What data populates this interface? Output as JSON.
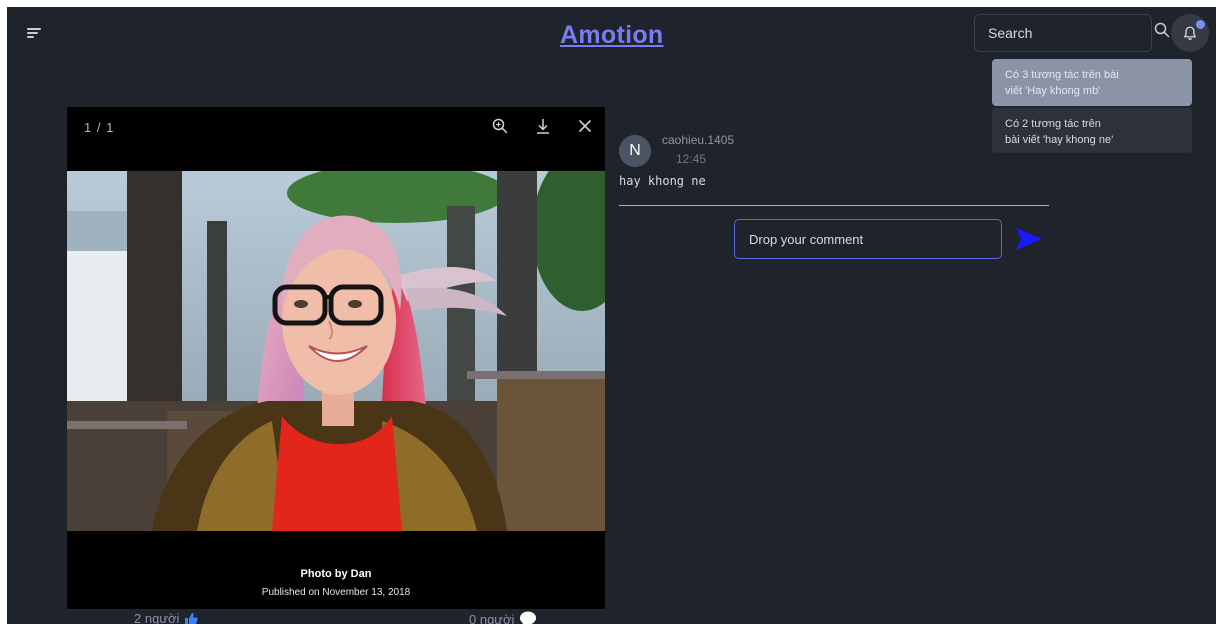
{
  "header": {
    "menu_icon": "hamburger-icon",
    "logo": "Amotion",
    "search": {
      "placeholder": "Search",
      "value": ""
    },
    "search_icon": "search-icon",
    "bell_icon": "bell-icon"
  },
  "notifications": [
    {
      "line1": "Có 3 tương tác trên bài",
      "line2": "viết 'Hay khong mb'"
    },
    {
      "line1": "Có 2 tương tác trên",
      "line2": "bài viết 'hay khong ne'"
    }
  ],
  "viewer": {
    "counter": "1 / 1",
    "icons": [
      "zoom-in-icon",
      "download-icon",
      "close-icon"
    ],
    "caption_title": "Photo by Dan",
    "caption_subtitle": "Published on November 13, 2018"
  },
  "reactions": {
    "likes": "2 người",
    "comments": "0 người",
    "like_icon": "thumbs-up-icon",
    "comment_icon": "speech-bubble-icon"
  },
  "comments": [
    {
      "avatar": "N",
      "username": "caohieu.1405",
      "time": "12:45",
      "text": "hay khong ne"
    }
  ],
  "comment_form": {
    "placeholder": "Drop your comment",
    "send_icon": "send-icon"
  },
  "colors": {
    "background": "#1f232b",
    "accent": "#7b7cf5",
    "send": "#1a1aff",
    "notification_active": "#8a94a6"
  }
}
